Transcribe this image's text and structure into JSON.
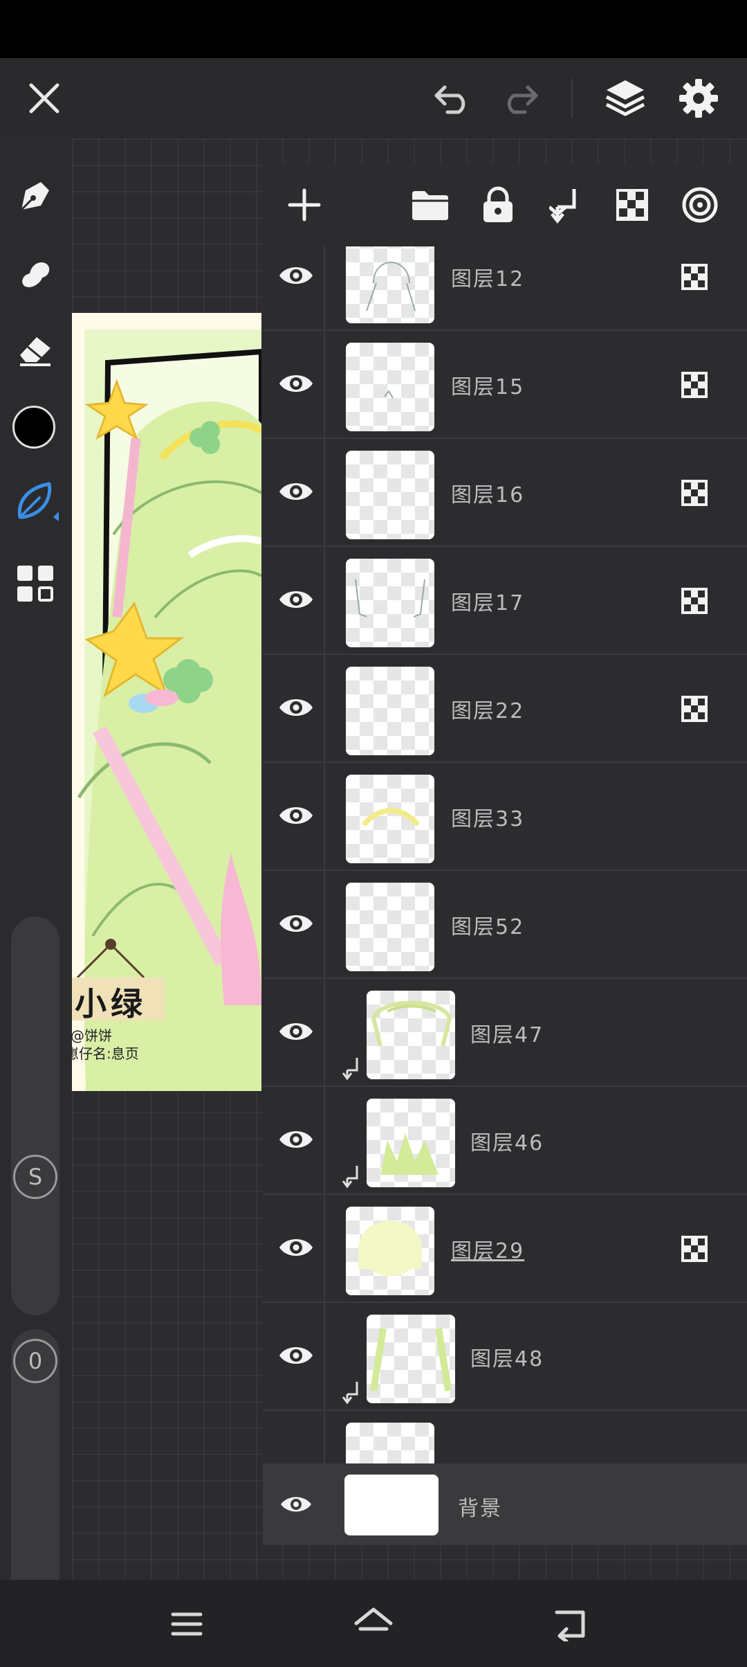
{
  "layers": [
    {
      "name": "图层12",
      "has_mask_icon": true,
      "clipped": false
    },
    {
      "name": "图层15",
      "has_mask_icon": true,
      "clipped": false
    },
    {
      "name": "图层16",
      "has_mask_icon": true,
      "clipped": false
    },
    {
      "name": "图层17",
      "has_mask_icon": true,
      "clipped": false
    },
    {
      "name": "图层22",
      "has_mask_icon": true,
      "clipped": false
    },
    {
      "name": "图层33",
      "has_mask_icon": false,
      "clipped": false
    },
    {
      "name": "图层52",
      "has_mask_icon": false,
      "clipped": false
    },
    {
      "name": "图层47",
      "has_mask_icon": false,
      "clipped": true
    },
    {
      "name": "图层46",
      "has_mask_icon": false,
      "clipped": true
    },
    {
      "name": "图层29",
      "has_mask_icon": true,
      "clipped": false,
      "selected": true
    },
    {
      "name": "图层48",
      "has_mask_icon": false,
      "clipped": true
    }
  ],
  "background_layer": {
    "name": "背景"
  },
  "artwork": {
    "sign_text": "小绿",
    "credit_line_1": "@饼饼",
    "credit_line_2": "崽仔名:息页"
  },
  "left_toolbar": {
    "brush_size_label": "S",
    "opacity_label": "0"
  },
  "colors": {
    "current_color": "#000000",
    "accent": "#3a8ee6",
    "panel_bg": "#2c2c2f",
    "selected_row": "#3a3a3d"
  },
  "icons": {
    "top_bar": [
      "close-icon",
      "undo-icon",
      "redo-icon",
      "layers-icon",
      "settings-icon"
    ],
    "panel_toolbar": [
      "add-layer-icon",
      "folder-icon",
      "lock-icon",
      "merge-down-icon",
      "alpha-lock-icon",
      "blend-mode-icon"
    ],
    "nav_bar": [
      "menu-icon",
      "home-icon",
      "back-icon"
    ]
  }
}
